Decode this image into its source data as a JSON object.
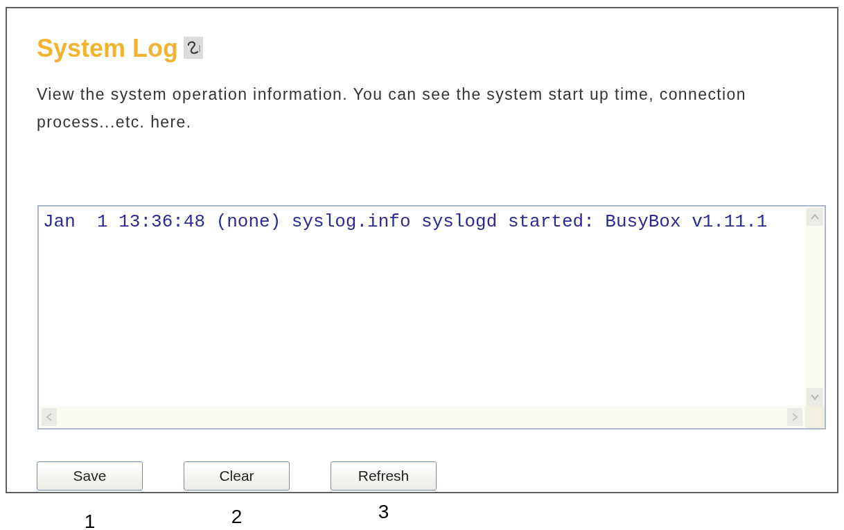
{
  "title": "System Log",
  "description": "View the system operation information. You can see the system start up time, connection process...etc. here.",
  "log": {
    "lines": [
      "Jan  1 13:36:48 (none) syslog.info syslogd started: BusyBox v1.11.1"
    ]
  },
  "buttons": [
    "Save",
    "Clear",
    "Refresh"
  ],
  "callouts": [
    "1",
    "2",
    "3"
  ]
}
